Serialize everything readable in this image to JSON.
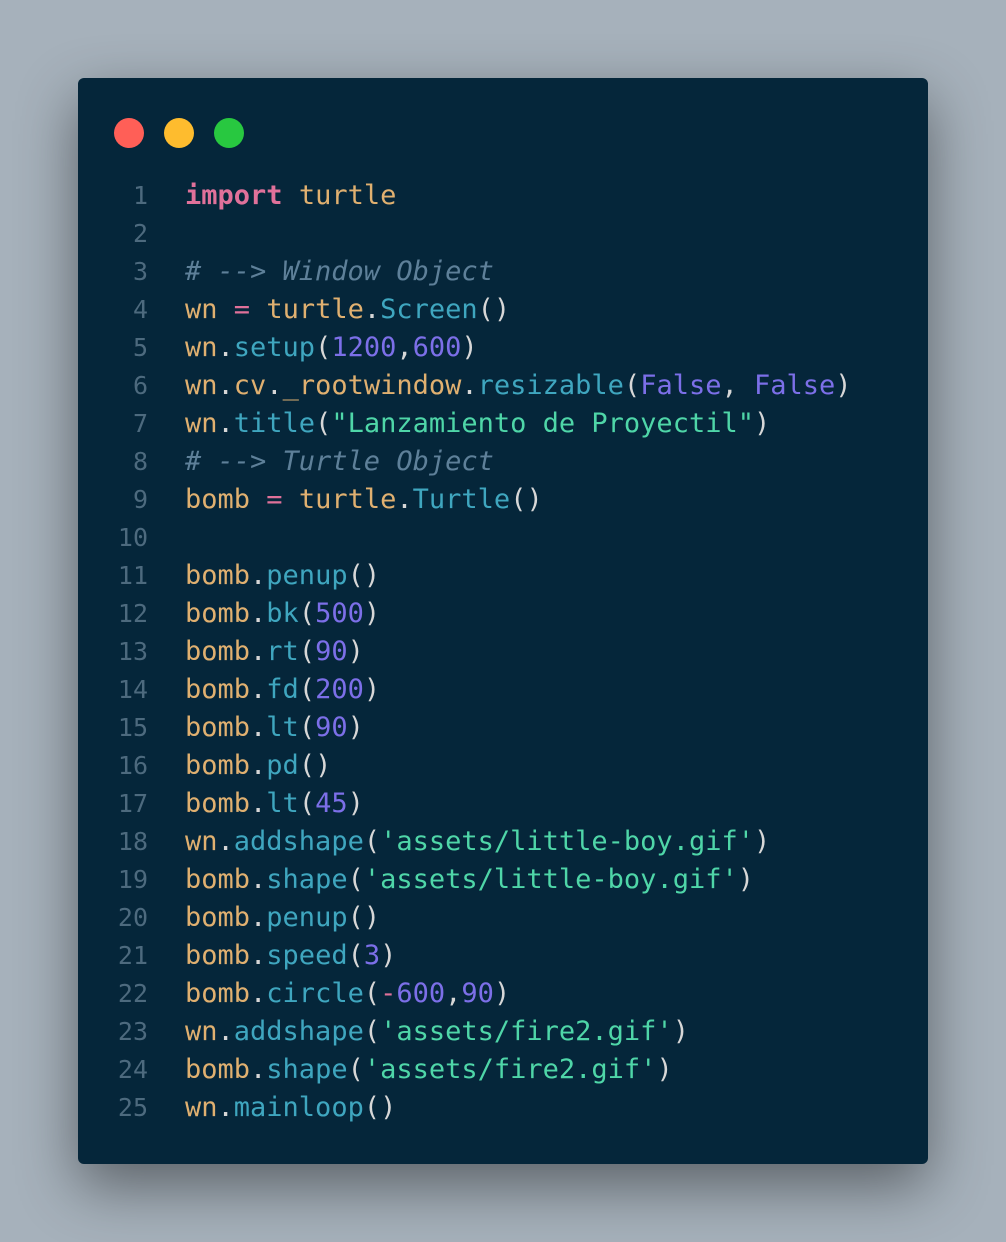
{
  "window_controls": {
    "close_color": "#ff5f57",
    "minimize_color": "#febc2e",
    "maximize_color": "#28c840"
  },
  "colors": {
    "background": "#a6b1bb",
    "editor_background": "#05263a",
    "keyword": "#e0719a",
    "identifier": "#e0b070",
    "function": "#3fa6bf",
    "number": "#7c6fe8",
    "string": "#4fd6a8",
    "comment": "#5e8099"
  },
  "language": "python",
  "lines": [
    {
      "n": "1",
      "tokens": [
        {
          "t": "kw",
          "v": "import"
        },
        {
          "t": "p",
          "v": " "
        },
        {
          "t": "id",
          "v": "turtle"
        }
      ]
    },
    {
      "n": "2",
      "tokens": []
    },
    {
      "n": "3",
      "tokens": [
        {
          "t": "cm",
          "v": "# --> Window Object"
        }
      ]
    },
    {
      "n": "4",
      "tokens": [
        {
          "t": "id",
          "v": "wn"
        },
        {
          "t": "p",
          "v": " "
        },
        {
          "t": "op",
          "v": "="
        },
        {
          "t": "p",
          "v": " "
        },
        {
          "t": "id",
          "v": "turtle"
        },
        {
          "t": "p",
          "v": "."
        },
        {
          "t": "fn",
          "v": "Screen"
        },
        {
          "t": "p",
          "v": "()"
        }
      ]
    },
    {
      "n": "5",
      "tokens": [
        {
          "t": "id",
          "v": "wn"
        },
        {
          "t": "p",
          "v": "."
        },
        {
          "t": "fn",
          "v": "setup"
        },
        {
          "t": "p",
          "v": "("
        },
        {
          "t": "num",
          "v": "1200"
        },
        {
          "t": "p",
          "v": ","
        },
        {
          "t": "num",
          "v": "600"
        },
        {
          "t": "p",
          "v": ")"
        }
      ]
    },
    {
      "n": "6",
      "tokens": [
        {
          "t": "id",
          "v": "wn"
        },
        {
          "t": "p",
          "v": "."
        },
        {
          "t": "id",
          "v": "cv"
        },
        {
          "t": "p",
          "v": "."
        },
        {
          "t": "id",
          "v": "_rootwindow"
        },
        {
          "t": "p",
          "v": "."
        },
        {
          "t": "fn",
          "v": "resizable"
        },
        {
          "t": "p",
          "v": "("
        },
        {
          "t": "num",
          "v": "False"
        },
        {
          "t": "p",
          "v": ", "
        },
        {
          "t": "num",
          "v": "False"
        },
        {
          "t": "p",
          "v": ")"
        }
      ]
    },
    {
      "n": "7",
      "tokens": [
        {
          "t": "id",
          "v": "wn"
        },
        {
          "t": "p",
          "v": "."
        },
        {
          "t": "fn",
          "v": "title"
        },
        {
          "t": "p",
          "v": "("
        },
        {
          "t": "str",
          "v": "\"Lanzamiento de Proyectil\""
        },
        {
          "t": "p",
          "v": ")"
        }
      ]
    },
    {
      "n": "8",
      "tokens": [
        {
          "t": "cm",
          "v": "# --> Turtle Object"
        }
      ]
    },
    {
      "n": "9",
      "tokens": [
        {
          "t": "id",
          "v": "bomb"
        },
        {
          "t": "p",
          "v": " "
        },
        {
          "t": "op",
          "v": "="
        },
        {
          "t": "p",
          "v": " "
        },
        {
          "t": "id",
          "v": "turtle"
        },
        {
          "t": "p",
          "v": "."
        },
        {
          "t": "fn",
          "v": "Turtle"
        },
        {
          "t": "p",
          "v": "()"
        }
      ]
    },
    {
      "n": "10",
      "tokens": []
    },
    {
      "n": "11",
      "tokens": [
        {
          "t": "id",
          "v": "bomb"
        },
        {
          "t": "p",
          "v": "."
        },
        {
          "t": "fn",
          "v": "penup"
        },
        {
          "t": "p",
          "v": "()"
        }
      ]
    },
    {
      "n": "12",
      "tokens": [
        {
          "t": "id",
          "v": "bomb"
        },
        {
          "t": "p",
          "v": "."
        },
        {
          "t": "fn",
          "v": "bk"
        },
        {
          "t": "p",
          "v": "("
        },
        {
          "t": "num",
          "v": "500"
        },
        {
          "t": "p",
          "v": ")"
        }
      ]
    },
    {
      "n": "13",
      "tokens": [
        {
          "t": "id",
          "v": "bomb"
        },
        {
          "t": "p",
          "v": "."
        },
        {
          "t": "fn",
          "v": "rt"
        },
        {
          "t": "p",
          "v": "("
        },
        {
          "t": "num",
          "v": "90"
        },
        {
          "t": "p",
          "v": ")"
        }
      ]
    },
    {
      "n": "14",
      "tokens": [
        {
          "t": "id",
          "v": "bomb"
        },
        {
          "t": "p",
          "v": "."
        },
        {
          "t": "fn",
          "v": "fd"
        },
        {
          "t": "p",
          "v": "("
        },
        {
          "t": "num",
          "v": "200"
        },
        {
          "t": "p",
          "v": ")"
        }
      ]
    },
    {
      "n": "15",
      "tokens": [
        {
          "t": "id",
          "v": "bomb"
        },
        {
          "t": "p",
          "v": "."
        },
        {
          "t": "fn",
          "v": "lt"
        },
        {
          "t": "p",
          "v": "("
        },
        {
          "t": "num",
          "v": "90"
        },
        {
          "t": "p",
          "v": ")"
        }
      ]
    },
    {
      "n": "16",
      "tokens": [
        {
          "t": "id",
          "v": "bomb"
        },
        {
          "t": "p",
          "v": "."
        },
        {
          "t": "fn",
          "v": "pd"
        },
        {
          "t": "p",
          "v": "()"
        }
      ]
    },
    {
      "n": "17",
      "tokens": [
        {
          "t": "id",
          "v": "bomb"
        },
        {
          "t": "p",
          "v": "."
        },
        {
          "t": "fn",
          "v": "lt"
        },
        {
          "t": "p",
          "v": "("
        },
        {
          "t": "num",
          "v": "45"
        },
        {
          "t": "p",
          "v": ")"
        }
      ]
    },
    {
      "n": "18",
      "tokens": [
        {
          "t": "id",
          "v": "wn"
        },
        {
          "t": "p",
          "v": "."
        },
        {
          "t": "fn",
          "v": "addshape"
        },
        {
          "t": "p",
          "v": "("
        },
        {
          "t": "str",
          "v": "'assets/little-boy.gif'"
        },
        {
          "t": "p",
          "v": ")"
        }
      ]
    },
    {
      "n": "19",
      "tokens": [
        {
          "t": "id",
          "v": "bomb"
        },
        {
          "t": "p",
          "v": "."
        },
        {
          "t": "fn",
          "v": "shape"
        },
        {
          "t": "p",
          "v": "("
        },
        {
          "t": "str",
          "v": "'assets/little-boy.gif'"
        },
        {
          "t": "p",
          "v": ")"
        }
      ]
    },
    {
      "n": "20",
      "tokens": [
        {
          "t": "id",
          "v": "bomb"
        },
        {
          "t": "p",
          "v": "."
        },
        {
          "t": "fn",
          "v": "penup"
        },
        {
          "t": "p",
          "v": "()"
        }
      ]
    },
    {
      "n": "21",
      "tokens": [
        {
          "t": "id",
          "v": "bomb"
        },
        {
          "t": "p",
          "v": "."
        },
        {
          "t": "fn",
          "v": "speed"
        },
        {
          "t": "p",
          "v": "("
        },
        {
          "t": "num",
          "v": "3"
        },
        {
          "t": "p",
          "v": ")"
        }
      ]
    },
    {
      "n": "22",
      "tokens": [
        {
          "t": "id",
          "v": "bomb"
        },
        {
          "t": "p",
          "v": "."
        },
        {
          "t": "fn",
          "v": "circle"
        },
        {
          "t": "p",
          "v": "("
        },
        {
          "t": "op",
          "v": "-"
        },
        {
          "t": "num",
          "v": "600"
        },
        {
          "t": "p",
          "v": ","
        },
        {
          "t": "num",
          "v": "90"
        },
        {
          "t": "p",
          "v": ")"
        }
      ]
    },
    {
      "n": "23",
      "tokens": [
        {
          "t": "id",
          "v": "wn"
        },
        {
          "t": "p",
          "v": "."
        },
        {
          "t": "fn",
          "v": "addshape"
        },
        {
          "t": "p",
          "v": "("
        },
        {
          "t": "str",
          "v": "'assets/fire2.gif'"
        },
        {
          "t": "p",
          "v": ")"
        }
      ]
    },
    {
      "n": "24",
      "tokens": [
        {
          "t": "id",
          "v": "bomb"
        },
        {
          "t": "p",
          "v": "."
        },
        {
          "t": "fn",
          "v": "shape"
        },
        {
          "t": "p",
          "v": "("
        },
        {
          "t": "str",
          "v": "'assets/fire2.gif'"
        },
        {
          "t": "p",
          "v": ")"
        }
      ]
    },
    {
      "n": "25",
      "tokens": [
        {
          "t": "id",
          "v": "wn"
        },
        {
          "t": "p",
          "v": "."
        },
        {
          "t": "fn",
          "v": "mainloop"
        },
        {
          "t": "p",
          "v": "()"
        }
      ]
    }
  ]
}
